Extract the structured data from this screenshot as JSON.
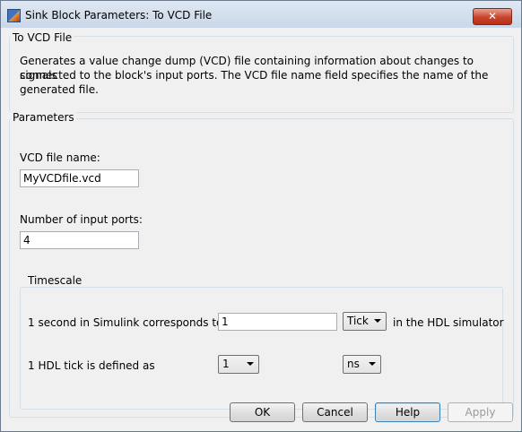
{
  "window": {
    "title": "Sink Block Parameters: To VCD File",
    "close_symbol": "✕"
  },
  "description_group": {
    "title": "To VCD File",
    "lines": [
      "Generates a value change dump (VCD) file containing information about changes to signals",
      "connected to the block's input ports. The VCD file name field specifies the name of the",
      "generated file."
    ]
  },
  "parameters": {
    "title": "Parameters",
    "vcd_file_name_label": "VCD file name:",
    "vcd_file_name_value": "MyVCDfile.vcd",
    "num_ports_label": "Number of input ports:",
    "num_ports_value": "4"
  },
  "timescale": {
    "title": "Timescale",
    "row1_label": "1 second in Simulink corresponds to",
    "row1_value": "1",
    "row1_unit": "Tick",
    "row1_suffix": "in the HDL simulator",
    "row2_label": "1 HDL tick is defined as",
    "row2_value": "1",
    "row2_unit": "ns"
  },
  "buttons": {
    "ok": "OK",
    "cancel": "Cancel",
    "help": "Help",
    "apply": "Apply"
  },
  "icons": {
    "app": "simulink-block-icon",
    "close": "close-icon",
    "dropdown": "chevron-down-icon"
  }
}
